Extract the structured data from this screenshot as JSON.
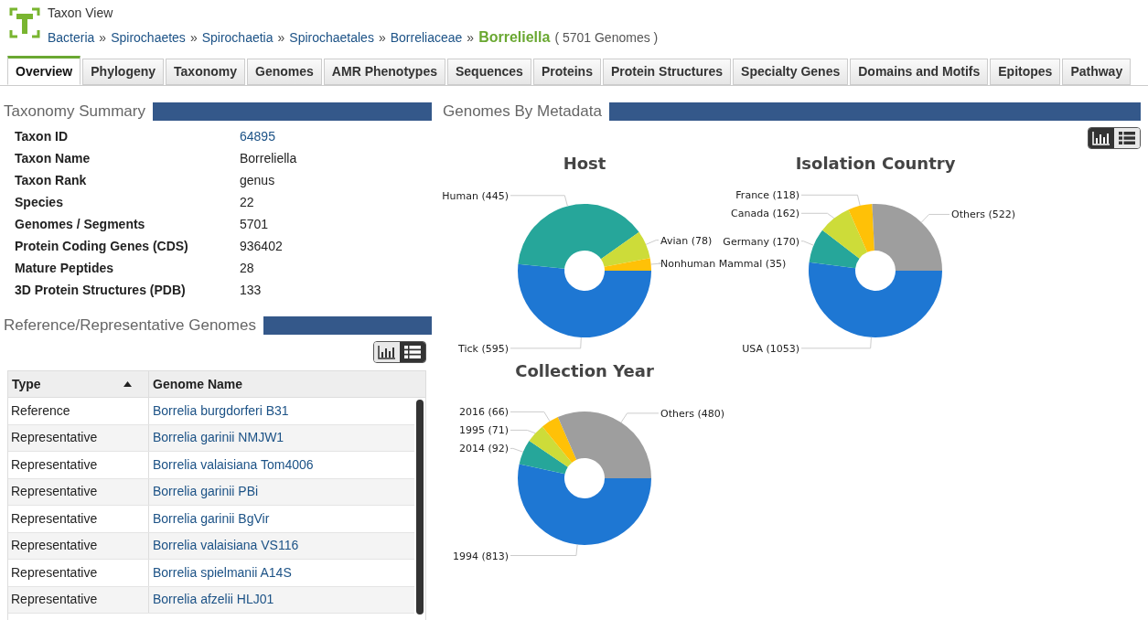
{
  "header": {
    "title": "Taxon View",
    "breadcrumb": [
      {
        "label": "Bacteria",
        "separator": "»"
      },
      {
        "label": "Spirochaetes",
        "separator": "»"
      },
      {
        "label": "Spirochaetia",
        "separator": "»"
      },
      {
        "label": "Spirochaetales",
        "separator": "»"
      },
      {
        "label": "Borreliaceae",
        "separator": "»"
      }
    ],
    "current": "Borreliella",
    "count": "( 5701 Genomes )"
  },
  "tabs": [
    {
      "label": "Overview",
      "selected": true
    },
    {
      "label": "Phylogeny",
      "selected": false
    },
    {
      "label": "Taxonomy",
      "selected": false
    },
    {
      "label": "Genomes",
      "selected": false
    },
    {
      "label": "AMR Phenotypes",
      "selected": false
    },
    {
      "label": "Sequences",
      "selected": false
    },
    {
      "label": "Proteins",
      "selected": false
    },
    {
      "label": "Protein Structures",
      "selected": false
    },
    {
      "label": "Specialty Genes",
      "selected": false
    },
    {
      "label": "Domains and Motifs",
      "selected": false
    },
    {
      "label": "Epitopes",
      "selected": false
    },
    {
      "label": "Pathway",
      "selected": false
    }
  ],
  "taxonomy_summary": {
    "title": "Taxonomy Summary",
    "rows": [
      {
        "label": "Taxon ID",
        "value": "64895",
        "kind": "link"
      },
      {
        "label": "Taxon Name",
        "value": "Borreliella",
        "kind": "text"
      },
      {
        "label": "Taxon Rank",
        "value": "genus",
        "kind": "text"
      },
      {
        "label": "Species",
        "value": "22",
        "kind": "text"
      },
      {
        "label": "Genomes / Segments",
        "value": "5701",
        "kind": "text"
      },
      {
        "label": "Protein Coding Genes (CDS)",
        "value": "936402",
        "kind": "text"
      },
      {
        "label": "Mature Peptides",
        "value": "28",
        "kind": "text"
      },
      {
        "label": "3D Protein Structures (PDB)",
        "value": "133",
        "kind": "text"
      }
    ]
  },
  "reference_genomes": {
    "title": "Reference/Representative Genomes",
    "view_toggle": [
      {
        "kind": "chart",
        "selected": false
      },
      {
        "kind": "list",
        "selected": true
      }
    ],
    "columns": [
      {
        "label": "Type",
        "sort_ascending": true
      },
      {
        "label": "Genome Name",
        "sort_ascending": false
      }
    ],
    "rows": [
      {
        "type": "Reference",
        "genome_name": "Borrelia burgdorferi B31"
      },
      {
        "type": "Representative",
        "genome_name": "Borrelia garinii NMJW1"
      },
      {
        "type": "Representative",
        "genome_name": "Borrelia valaisiana Tom4006"
      },
      {
        "type": "Representative",
        "genome_name": "Borrelia garinii PBi"
      },
      {
        "type": "Representative",
        "genome_name": "Borrelia garinii BgVir"
      },
      {
        "type": "Representative",
        "genome_name": "Borrelia valaisiana VS116"
      },
      {
        "type": "Representative",
        "genome_name": "Borrelia spielmanii A14S"
      },
      {
        "type": "Representative",
        "genome_name": "Borrelia afzelii HLJ01"
      }
    ]
  },
  "genomes_by_metadata": {
    "title": "Genomes By Metadata",
    "view_toggle": [
      {
        "kind": "chart",
        "selected": true
      },
      {
        "kind": "list",
        "selected": false
      }
    ],
    "charts": [
      {
        "chart_data": {
          "type": "donut",
          "title": "Host",
          "values": [
            595,
            445,
            78,
            35
          ],
          "value_labels": [
            "Tick (595)",
            "Human (445)",
            "Avian (78)",
            "Nonhuman Mammal (35)"
          ]
        }
      },
      {
        "chart_data": {
          "type": "donut",
          "title": "Isolation Country",
          "values": [
            1053,
            170,
            162,
            118,
            522
          ],
          "value_labels": [
            "USA (1053)",
            "Germany (170)",
            "Canada (162)",
            "France (118)",
            "Others (522)"
          ]
        }
      },
      {
        "chart_data": {
          "type": "donut",
          "title": "Collection Year",
          "values": [
            813,
            92,
            71,
            66,
            480
          ],
          "value_labels": [
            "1994 (813)",
            "2014 (92)",
            "1995 (71)",
            "2016 (66)",
            "Others (480)"
          ]
        }
      }
    ]
  }
}
